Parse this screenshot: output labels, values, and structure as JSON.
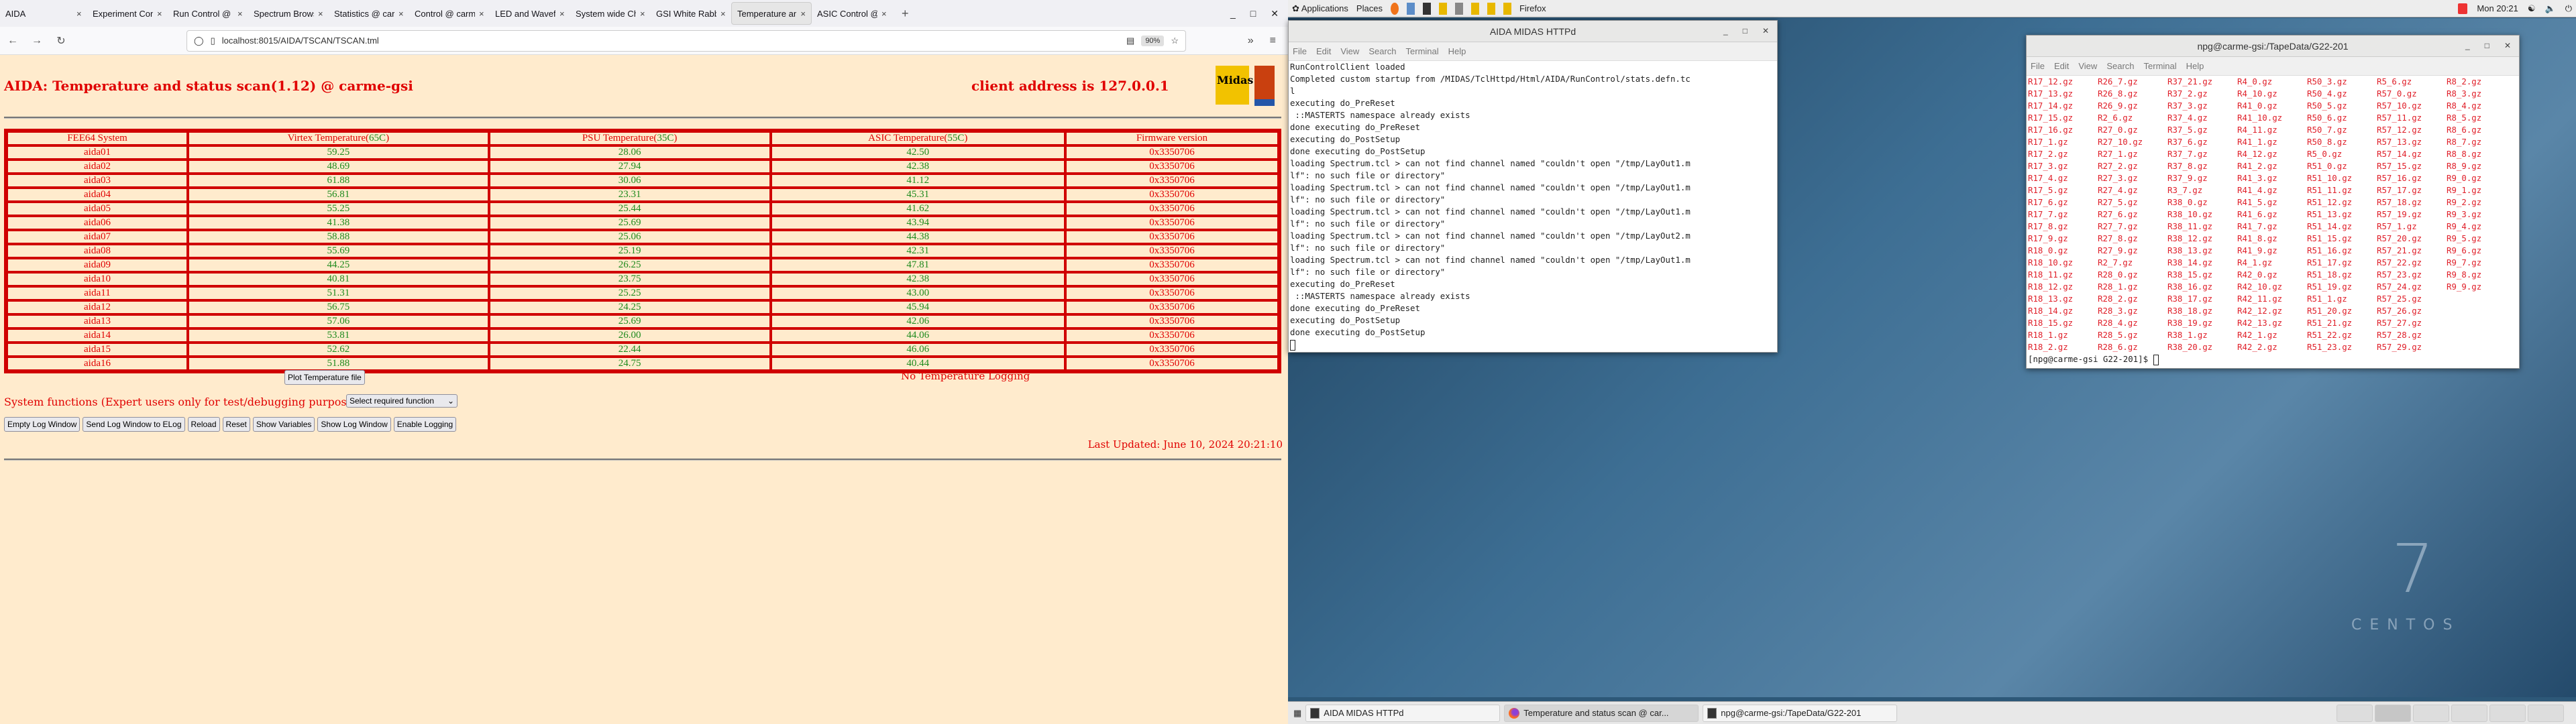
{
  "browser": {
    "tabs": [
      {
        "label": "AIDA",
        "active": false
      },
      {
        "label": "Experiment Control",
        "active": false
      },
      {
        "label": "Run Control @ carme",
        "active": false
      },
      {
        "label": "Spectrum Browser",
        "active": false
      },
      {
        "label": "Statistics @ carme",
        "active": false
      },
      {
        "label": "Control @ carme-gsi",
        "active": false
      },
      {
        "label": "LED and Waveform",
        "active": false
      },
      {
        "label": "System wide Check",
        "active": false
      },
      {
        "label": "GSI White Rabbit T",
        "active": false
      },
      {
        "label": "Temperature and status",
        "active": true
      },
      {
        "label": "ASIC Control @ car",
        "active": false
      }
    ],
    "url": "localhost:8015/AIDA/TSCAN/TSCAN.tml",
    "zoom": "90%"
  },
  "page": {
    "title": "AIDA: Temperature and status scan(1.12) @ carme-gsi",
    "client_address": "client address is 127.0.0.1",
    "logos": {
      "midas": "Midas",
      "tcl": "TCL"
    },
    "table": {
      "headers": [
        {
          "text": "FEE64 System",
          "limit": ""
        },
        {
          "text": "Virtex Temperature(",
          "limit": "65C",
          "close": ")"
        },
        {
          "text": "PSU Temperature(",
          "limit": "35C",
          "close": ")"
        },
        {
          "text": "ASIC Temperature(",
          "limit": "55C",
          "close": ")"
        },
        {
          "text": "Firmware version",
          "limit": ""
        }
      ],
      "rows": [
        [
          "aida01",
          "59.25",
          "28.06",
          "42.50",
          "0x3350706"
        ],
        [
          "aida02",
          "48.69",
          "27.94",
          "42.38",
          "0x3350706"
        ],
        [
          "aida03",
          "61.88",
          "30.06",
          "41.12",
          "0x3350706"
        ],
        [
          "aida04",
          "56.81",
          "23.31",
          "45.31",
          "0x3350706"
        ],
        [
          "aida05",
          "55.25",
          "25.44",
          "41.62",
          "0x3350706"
        ],
        [
          "aida06",
          "41.38",
          "25.69",
          "43.94",
          "0x3350706"
        ],
        [
          "aida07",
          "58.88",
          "25.06",
          "44.38",
          "0x3350706"
        ],
        [
          "aida08",
          "55.69",
          "25.19",
          "42.31",
          "0x3350706"
        ],
        [
          "aida09",
          "44.25",
          "26.25",
          "47.81",
          "0x3350706"
        ],
        [
          "aida10",
          "40.81",
          "23.75",
          "42.38",
          "0x3350706"
        ],
        [
          "aida11",
          "51.31",
          "25.25",
          "43.00",
          "0x3350706"
        ],
        [
          "aida12",
          "56.75",
          "24.25",
          "45.94",
          "0x3350706"
        ],
        [
          "aida13",
          "57.06",
          "25.69",
          "42.06",
          "0x3350706"
        ],
        [
          "aida14",
          "53.81",
          "26.00",
          "44.06",
          "0x3350706"
        ],
        [
          "aida15",
          "52.62",
          "22.44",
          "46.06",
          "0x3350706"
        ],
        [
          "aida16",
          "51.88",
          "24.75",
          "40.44",
          "0x3350706"
        ]
      ]
    },
    "plot_button": "Plot Temperature file",
    "logging_status": "No Temperature Logging",
    "system_functions_label": "System functions (Expert users only for test/debugging purposes!!!)",
    "function_select": "Select required function",
    "buttons": [
      "Empty Log Window",
      "Send Log Window to ELog",
      "Reload",
      "Reset",
      "Show Variables",
      "Show Log Window",
      "Enable Logging"
    ],
    "last_updated": "Last Updated: June 10, 2024 20:21:10"
  },
  "panel": {
    "applications": "Applications",
    "places": "Places",
    "active_app": "Firefox",
    "clock": "Mon 20:21"
  },
  "term1": {
    "title": "AIDA MIDAS HTTPd",
    "menu": [
      "File",
      "Edit",
      "View",
      "Search",
      "Terminal",
      "Help"
    ],
    "lines": [
      "RunControlClient loaded",
      "Completed custom startup from /MIDAS/TclHttpd/Html/AIDA/RunControl/stats.defn.tc",
      "l",
      "executing do_PreReset",
      " ::MASTERTS namespace already exists",
      "done executing do_PreReset",
      "executing do_PostSetup",
      "done executing do_PostSetup",
      "loading Spectrum.tcl > can not find channel named \"couldn't open \"/tmp/LayOut1.m",
      "lf\": no such file or directory\"",
      "loading Spectrum.tcl > can not find channel named \"couldn't open \"/tmp/LayOut1.m",
      "lf\": no such file or directory\"",
      "loading Spectrum.tcl > can not find channel named \"couldn't open \"/tmp/LayOut1.m",
      "lf\": no such file or directory\"",
      "loading Spectrum.tcl > can not find channel named \"couldn't open \"/tmp/LayOut2.m",
      "lf\": no such file or directory\"",
      "loading Spectrum.tcl > can not find channel named \"couldn't open \"/tmp/LayOut1.m",
      "lf\": no such file or directory\"",
      "executing do_PreReset",
      " ::MASTERTS namespace already exists",
      "done executing do_PreReset",
      "executing do_PostSetup",
      "done executing do_PostSetup"
    ]
  },
  "term2": {
    "title": "npg@carme-gsi:/TapeData/G22-201",
    "menu": [
      "File",
      "Edit",
      "View",
      "Search",
      "Terminal",
      "Help"
    ],
    "rows": [
      [
        "R17_12.gz",
        "R26_7.gz",
        "R37_21.gz",
        "R4_0.gz",
        "R50_3.gz",
        "R5_6.gz",
        "R8_2.gz"
      ],
      [
        "R17_13.gz",
        "R26_8.gz",
        "R37_2.gz",
        "R4_10.gz",
        "R50_4.gz",
        "R57_0.gz",
        "R8_3.gz"
      ],
      [
        "R17_14.gz",
        "R26_9.gz",
        "R37_3.gz",
        "R41_0.gz",
        "R50_5.gz",
        "R57_10.gz",
        "R8_4.gz"
      ],
      [
        "R17_15.gz",
        "R2_6.gz",
        "R37_4.gz",
        "R41_10.gz",
        "R50_6.gz",
        "R57_11.gz",
        "R8_5.gz"
      ],
      [
        "R17_16.gz",
        "R27_0.gz",
        "R37_5.gz",
        "R4_11.gz",
        "R50_7.gz",
        "R57_12.gz",
        "R8_6.gz"
      ],
      [
        "R17_1.gz",
        "R27_10.gz",
        "R37_6.gz",
        "R41_1.gz",
        "R50_8.gz",
        "R57_13.gz",
        "R8_7.gz"
      ],
      [
        "R17_2.gz",
        "R27_1.gz",
        "R37_7.gz",
        "R4_12.gz",
        "R5_0.gz",
        "R57_14.gz",
        "R8_8.gz"
      ],
      [
        "R17_3.gz",
        "R27_2.gz",
        "R37_8.gz",
        "R41_2.gz",
        "R51_0.gz",
        "R57_15.gz",
        "R8_9.gz"
      ],
      [
        "R17_4.gz",
        "R27_3.gz",
        "R37_9.gz",
        "R41_3.gz",
        "R51_10.gz",
        "R57_16.gz",
        "R9_0.gz"
      ],
      [
        "R17_5.gz",
        "R27_4.gz",
        "R3_7.gz",
        "R41_4.gz",
        "R51_11.gz",
        "R57_17.gz",
        "R9_1.gz"
      ],
      [
        "R17_6.gz",
        "R27_5.gz",
        "R38_0.gz",
        "R41_5.gz",
        "R51_12.gz",
        "R57_18.gz",
        "R9_2.gz"
      ],
      [
        "R17_7.gz",
        "R27_6.gz",
        "R38_10.gz",
        "R41_6.gz",
        "R51_13.gz",
        "R57_19.gz",
        "R9_3.gz"
      ],
      [
        "R17_8.gz",
        "R27_7.gz",
        "R38_11.gz",
        "R41_7.gz",
        "R51_14.gz",
        "R57_1.gz",
        "R9_4.gz"
      ],
      [
        "R17_9.gz",
        "R27_8.gz",
        "R38_12.gz",
        "R41_8.gz",
        "R51_15.gz",
        "R57_20.gz",
        "R9_5.gz"
      ],
      [
        "R18_0.gz",
        "R27_9.gz",
        "R38_13.gz",
        "R41_9.gz",
        "R51_16.gz",
        "R57_21.gz",
        "R9_6.gz"
      ],
      [
        "R18_10.gz",
        "R2_7.gz",
        "R38_14.gz",
        "R4_1.gz",
        "R51_17.gz",
        "R57_22.gz",
        "R9_7.gz"
      ],
      [
        "R18_11.gz",
        "R28_0.gz",
        "R38_15.gz",
        "R42_0.gz",
        "R51_18.gz",
        "R57_23.gz",
        "R9_8.gz"
      ],
      [
        "R18_12.gz",
        "R28_1.gz",
        "R38_16.gz",
        "R42_10.gz",
        "R51_19.gz",
        "R57_24.gz",
        "R9_9.gz"
      ],
      [
        "R18_13.gz",
        "R28_2.gz",
        "R38_17.gz",
        "R42_11.gz",
        "R51_1.gz",
        "R57_25.gz",
        ""
      ],
      [
        "R18_14.gz",
        "R28_3.gz",
        "R38_18.gz",
        "R42_12.gz",
        "R51_20.gz",
        "R57_26.gz",
        ""
      ],
      [
        "R18_15.gz",
        "R28_4.gz",
        "R38_19.gz",
        "R42_13.gz",
        "R51_21.gz",
        "R57_27.gz",
        ""
      ],
      [
        "R18_1.gz",
        "R28_5.gz",
        "R38_1.gz",
        "R42_1.gz",
        "R51_22.gz",
        "R57_28.gz",
        ""
      ],
      [
        "R18_2.gz",
        "R28_6.gz",
        "R38_20.gz",
        "R42_2.gz",
        "R51_23.gz",
        "R57_29.gz",
        ""
      ]
    ],
    "prompt": "[npg@carme-gsi G22-201]$ "
  },
  "wallpaper": {
    "number": "7",
    "word": "CENTOS"
  },
  "taskbar": {
    "items": [
      {
        "label": "AIDA MIDAS HTTPd",
        "icon": "terminal-icon",
        "active": false
      },
      {
        "label": "Temperature and status scan @ car...",
        "icon": "firefox-icon",
        "active": true
      },
      {
        "label": "npg@carme-gsi:/TapeData/G22-201",
        "icon": "terminal-icon",
        "active": false
      }
    ],
    "workspaces": 6,
    "current_workspace": 2
  },
  "colors": {
    "page_bg": "#ffebcd",
    "accent_red": "#e00000",
    "ok_green": "#1d8b1d"
  }
}
